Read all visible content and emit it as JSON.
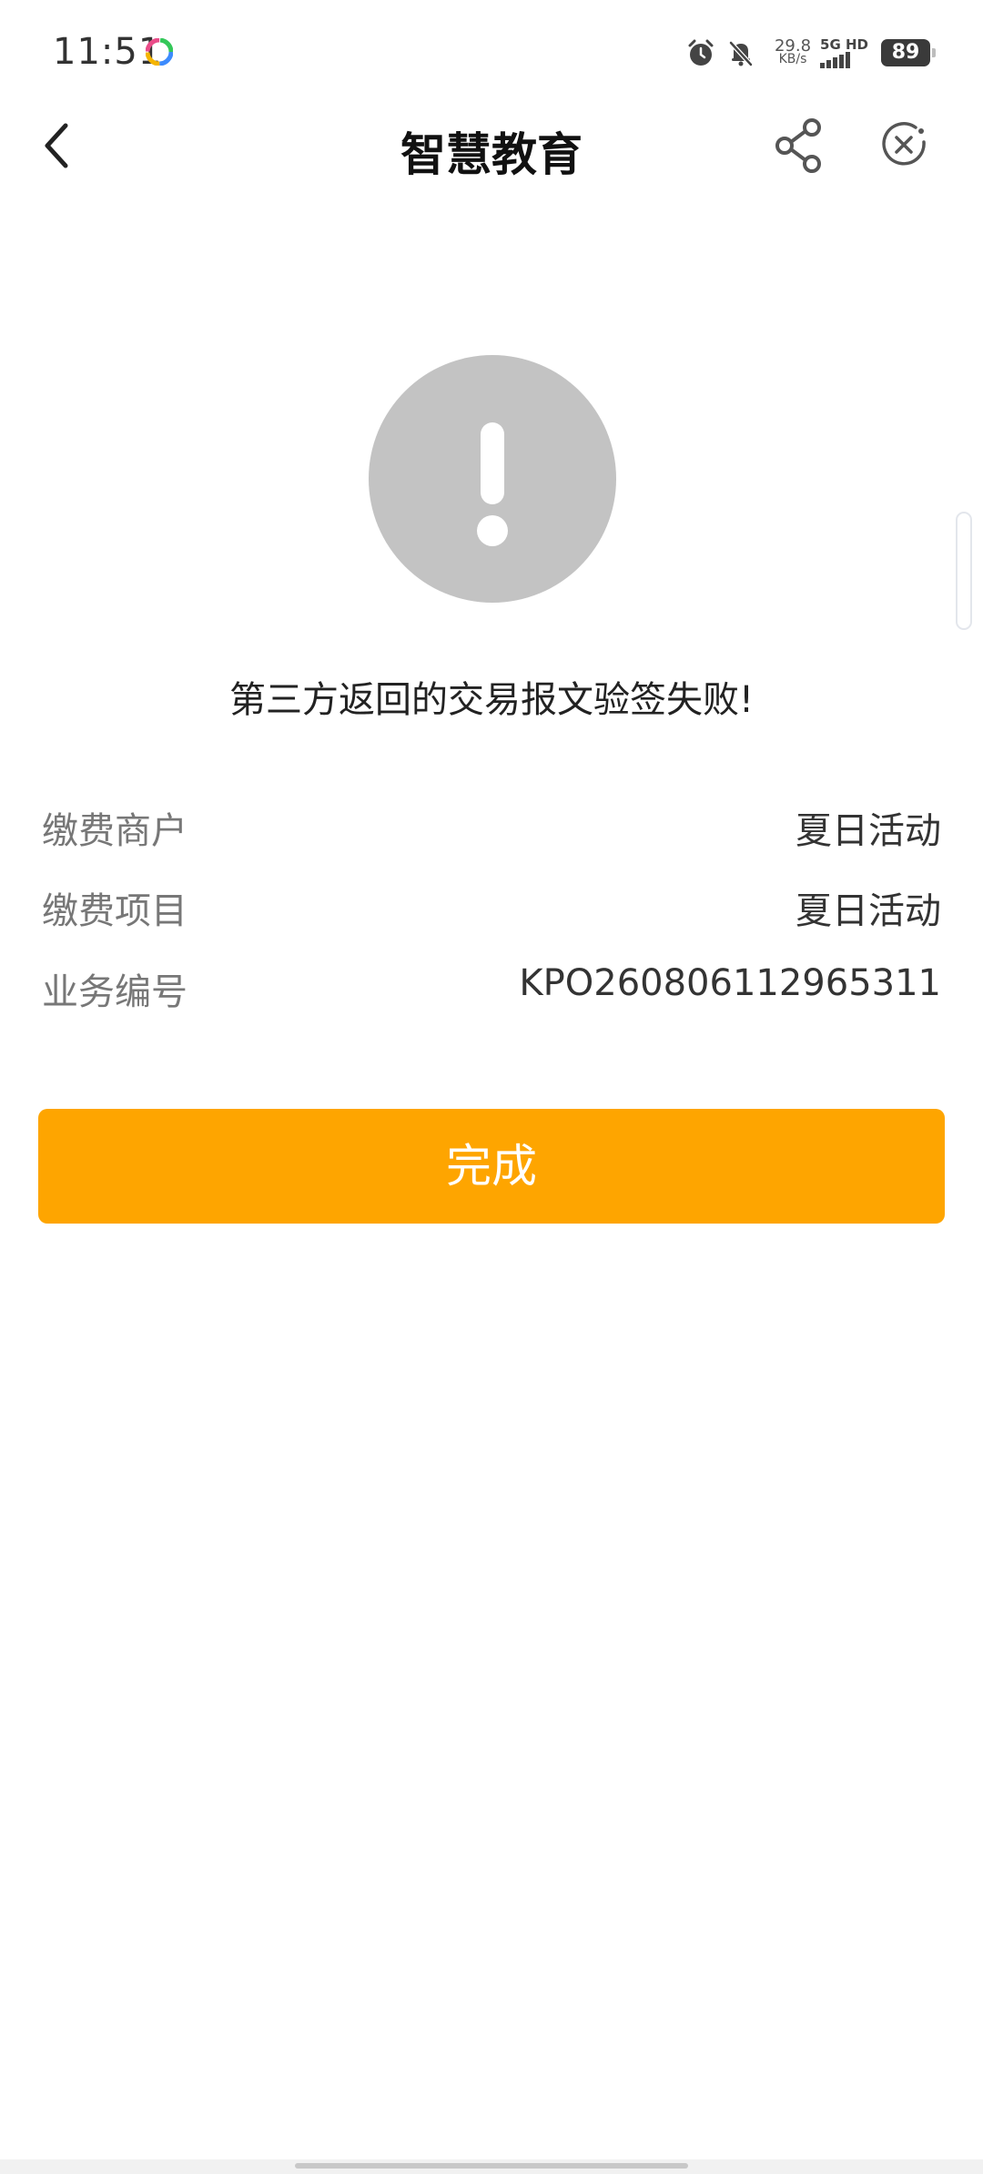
{
  "status_bar": {
    "time": "11:51",
    "net_speed_value": "29.8",
    "net_speed_unit": "KB/s",
    "signal_label": "5G HD",
    "battery": "89",
    "icons": [
      "colorful-app-icon",
      "alarm-icon",
      "muted-bell-icon",
      "signal-icon",
      "battery-icon"
    ]
  },
  "nav": {
    "title": "智慧教育",
    "icons": [
      "back-arrow-icon",
      "share-icon",
      "close-circle-icon"
    ]
  },
  "result": {
    "icon": "exclamation-icon",
    "icon_color": "#c3c3c3",
    "message": "第三方返回的交易报文验签失败!"
  },
  "details": [
    {
      "label": "缴费商户",
      "value": "夏日活动"
    },
    {
      "label": "缴费项目",
      "value": "夏日活动"
    },
    {
      "label": "业务编号",
      "value": "KPO260806112965311"
    }
  ],
  "done_button": {
    "label": "完成",
    "color": "#fea500"
  }
}
